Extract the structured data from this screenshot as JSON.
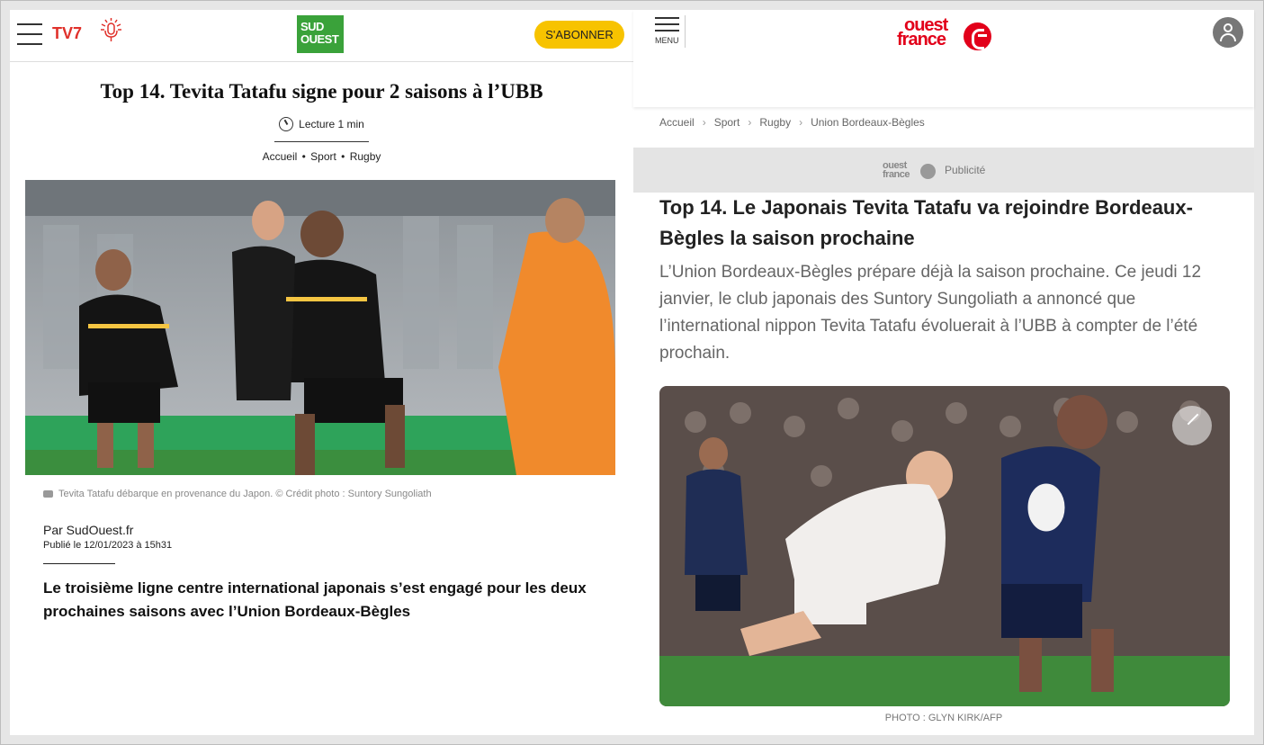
{
  "sudouest": {
    "header": {
      "tv7_label": "TV7",
      "logo_line1": "SUD",
      "logo_line2": "OUEST",
      "subscribe_label": "S'ABONNER"
    },
    "article": {
      "title": "Top 14. Tevita Tatafu signe pour 2 saisons à l’UBB",
      "read_time": "Lecture 1 min",
      "breadcrumbs": [
        "Accueil",
        "Sport",
        "Rugby"
      ],
      "photo_caption": "Tevita Tatafu débarque en provenance du Japon. © Crédit photo : Suntory Sungoliath",
      "byline": "Par SudOuest.fr",
      "published": "Publié le 12/01/2023 à 15h31",
      "lead": "Le troisième ligne centre international japonais s’est engagé pour les deux prochaines saisons avec l’Union Bordeaux-Bègles"
    }
  },
  "ouestfrance": {
    "header": {
      "menu_label": "MENU",
      "logo_line1": "ouest",
      "logo_line2": "france"
    },
    "breadcrumbs": [
      "Accueil",
      "Sport",
      "Rugby",
      "Union Bordeaux-Bègles"
    ],
    "ad": {
      "logo_line1": "ouest",
      "logo_line2": "france",
      "label": "Publicité"
    },
    "article": {
      "title": "Top 14. Le Japonais Tevita Tatafu va rejoindre Bordeaux-Bègles la saison prochaine",
      "lead": "L’Union Bordeaux-Bègles prépare déjà la saison prochaine. Ce jeudi 12 janvier, le club japonais des Suntory Sungoliath a annoncé que l’international nippon Tevita Tatafu évoluerait à l’UBB à compter de l’été prochain.",
      "photo_credit": "PHOTO : GLYN KIRK/AFP"
    }
  },
  "colors": {
    "tv7_red": "#e0312b",
    "sudouest_green": "#3aa23a",
    "subscribe_yellow": "#f7c300",
    "ouestfrance_red": "#e2001a"
  }
}
